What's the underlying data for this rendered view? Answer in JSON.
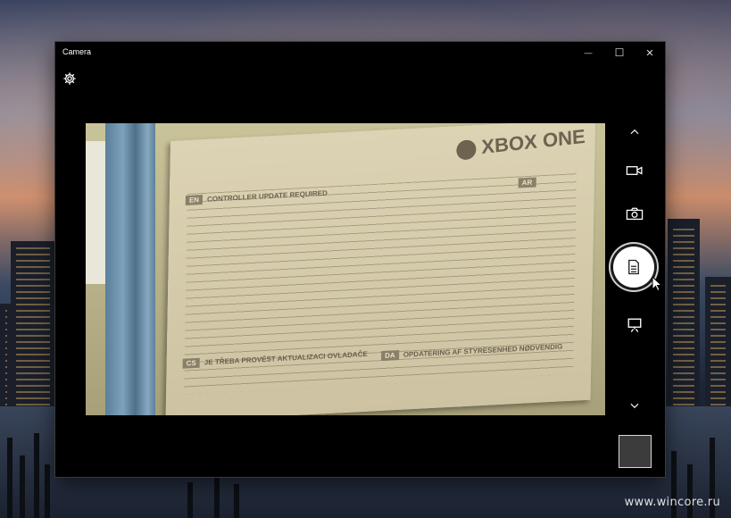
{
  "window": {
    "title": "Camera",
    "controls": {
      "minimize": "—",
      "maximize": "☐",
      "close": "✕"
    }
  },
  "viewfinder": {
    "brand_text": "XBOX ONE",
    "sections": [
      {
        "badge": "EN",
        "heading": "CONTROLLER UPDATE REQUIRED"
      },
      {
        "badge": "CS",
        "heading": "JE TŘEBA PROVÉST AKTUALIZACI OVLADAČE"
      },
      {
        "badge": "DA",
        "heading": "OPDATERING AF STYRESENHED NØDVENDIG"
      },
      {
        "badge": "AR",
        "heading": ""
      }
    ]
  },
  "icons": {
    "settings": "gear-icon",
    "scroll_up": "chevron-up-icon",
    "video_mode": "video-camera-icon",
    "photo_mode": "camera-icon",
    "document_mode": "document-icon",
    "whiteboard_mode": "whiteboard-icon",
    "scroll_down": "chevron-down-icon"
  },
  "selected_mode": "document",
  "watermark": "www.wincore.ru"
}
